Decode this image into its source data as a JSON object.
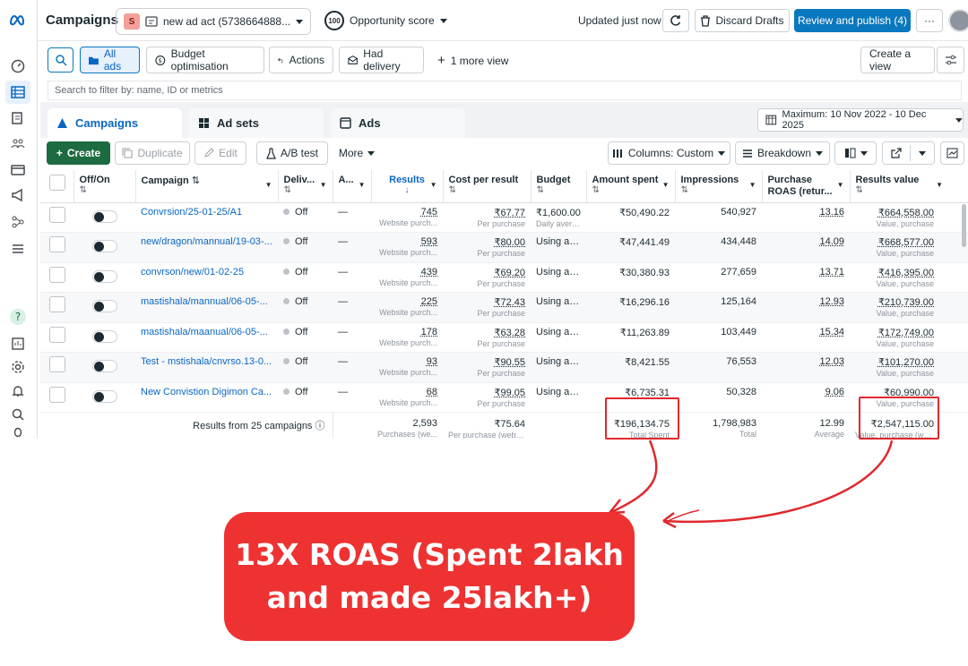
{
  "app": {
    "title": "Campaigns",
    "account_badge": "S",
    "account_name": "new ad act (5738664888...",
    "opportunity_score_value": "100",
    "opportunity_score_label": "Opportunity score",
    "updated_text": "Updated just now",
    "discard_label": "Discard Drafts",
    "review_label": "Review and publish (4)",
    "more_label": "···"
  },
  "filters": {
    "all_ads": "All ads",
    "budget_opt": "Budget optimisation",
    "actions": "Actions",
    "had_delivery": "Had delivery",
    "more_view": "1 more view",
    "create_view": "Create a view",
    "search_placeholder": "Search to filter by: name, ID or metrics"
  },
  "tabs": {
    "campaigns": "Campaigns",
    "ad_sets": "Ad sets",
    "ads": "Ads",
    "date_range": "Maximum: 10 Nov 2022 - 10 Dec 2025"
  },
  "toolbar": {
    "create": "Create",
    "duplicate": "Duplicate",
    "edit": "Edit",
    "ab_test": "A/B test",
    "more": "More",
    "columns": "Columns: Custom",
    "breakdown": "Breakdown"
  },
  "table": {
    "headers": {
      "off_on": "Off/On",
      "campaign": "Campaign",
      "delivery": "Deliv...",
      "attribution": "A...",
      "results": "Results",
      "cost_per_result": "Cost per result",
      "budget": "Budget",
      "amount_spent": "Amount spent",
      "impressions": "Impressions",
      "purchase_roas": "Purchase ROAS (retur...",
      "results_value": "Results value"
    },
    "rows": [
      {
        "name": "Convrsion/25-01-25/A1",
        "delivery": "Off",
        "attr": "—",
        "results": "745",
        "results_sub": "Website purch...",
        "cpr": "₹67.77",
        "cpr_sub": "Per purchase",
        "budget": "₹1,600.00",
        "budget_sub": "Daily avera...",
        "spent": "₹50,490.22",
        "impressions": "540,927",
        "roas": "13.16",
        "value": "₹664,558.00",
        "value_sub": "Value, purchase"
      },
      {
        "name": "new/dragon/mannual/19-03-...",
        "delivery": "Off",
        "attr": "—",
        "results": "593",
        "results_sub": "Website purch...",
        "cpr": "₹80.00",
        "cpr_sub": "Per purchase",
        "budget": "Using ad...",
        "budget_sub": "",
        "spent": "₹47,441.49",
        "impressions": "434,448",
        "roas": "14.09",
        "value": "₹668,577.00",
        "value_sub": "Value, purchase"
      },
      {
        "name": "convrson/new/01-02-25",
        "delivery": "Off",
        "attr": "—",
        "results": "439",
        "results_sub": "Website purch...",
        "cpr": "₹69.20",
        "cpr_sub": "Per purchase",
        "budget": "Using ad...",
        "budget_sub": "",
        "spent": "₹30,380.93",
        "impressions": "277,659",
        "roas": "13.71",
        "value": "₹416,395.00",
        "value_sub": "Value, purchase"
      },
      {
        "name": "mastishala/mannual/06-05-...",
        "delivery": "Off",
        "attr": "—",
        "results": "225",
        "results_sub": "Website purch...",
        "cpr": "₹72.43",
        "cpr_sub": "Per purchase",
        "budget": "Using ad...",
        "budget_sub": "",
        "spent": "₹16,296.16",
        "impressions": "125,164",
        "roas": "12.93",
        "value": "₹210,739.00",
        "value_sub": "Value, purchase"
      },
      {
        "name": "mastishala/maanual/06-05-...",
        "delivery": "Off",
        "attr": "—",
        "results": "178",
        "results_sub": "Website purch...",
        "cpr": "₹63.28",
        "cpr_sub": "Per purchase",
        "budget": "Using ad...",
        "budget_sub": "",
        "spent": "₹11,263.89",
        "impressions": "103,449",
        "roas": "15.34",
        "value": "₹172,749.00",
        "value_sub": "Value, purchase"
      },
      {
        "name": "Test - mstishala/cnvrso.13-0...",
        "delivery": "Off",
        "attr": "—",
        "results": "93",
        "results_sub": "Website purch...",
        "cpr": "₹90.55",
        "cpr_sub": "Per purchase",
        "budget": "Using ad...",
        "budget_sub": "",
        "spent": "₹8,421.55",
        "impressions": "76,553",
        "roas": "12.03",
        "value": "₹101,270.00",
        "value_sub": "Value, purchase"
      },
      {
        "name": "New Convistion Digimon Ca...",
        "delivery": "Off",
        "attr": "—",
        "results": "68",
        "results_sub": "Website purch...",
        "cpr": "₹99.05",
        "cpr_sub": "Per purchase",
        "budget": "Using ad...",
        "budget_sub": "",
        "spent": "₹6,735.31",
        "impressions": "50,328",
        "roas": "9.06",
        "value": "₹60,990.00",
        "value_sub": "Value, purchase"
      }
    ],
    "footer": {
      "label": "Results from 25 campaigns",
      "results": "2,593",
      "results_sub": "Purchases (we...",
      "cpr": "₹75.64",
      "cpr_sub": "Per purchase (webs...",
      "spent": "₹196,134.75",
      "spent_sub": "Total Spent",
      "impressions": "1,798,983",
      "impressions_sub": "Total",
      "roas": "12.99",
      "roas_sub": "Average",
      "value": "₹2,547,115.00",
      "value_sub": "Value, purchase (we..."
    }
  },
  "annotation": {
    "text": "13X ROAS (Spent 2lakh\nand made 25lakh+)",
    "color": "#ee3232"
  }
}
